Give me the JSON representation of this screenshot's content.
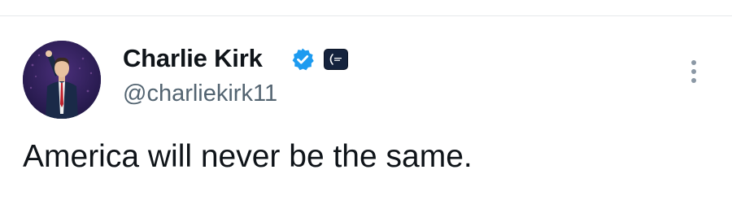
{
  "tweet": {
    "author": {
      "display_name": "Charlie Kirk",
      "handle": "@charliekirk11",
      "verified": true,
      "verified_badge_color": "#1d9bf0",
      "affiliate_badge_icon": "organization-affiliate-icon"
    },
    "text": "America will never be the same.",
    "more_icon": "more-options-icon"
  },
  "colors": {
    "primary_text": "#0f1419",
    "secondary_text": "#536471",
    "divider": "#e6e9eb"
  }
}
